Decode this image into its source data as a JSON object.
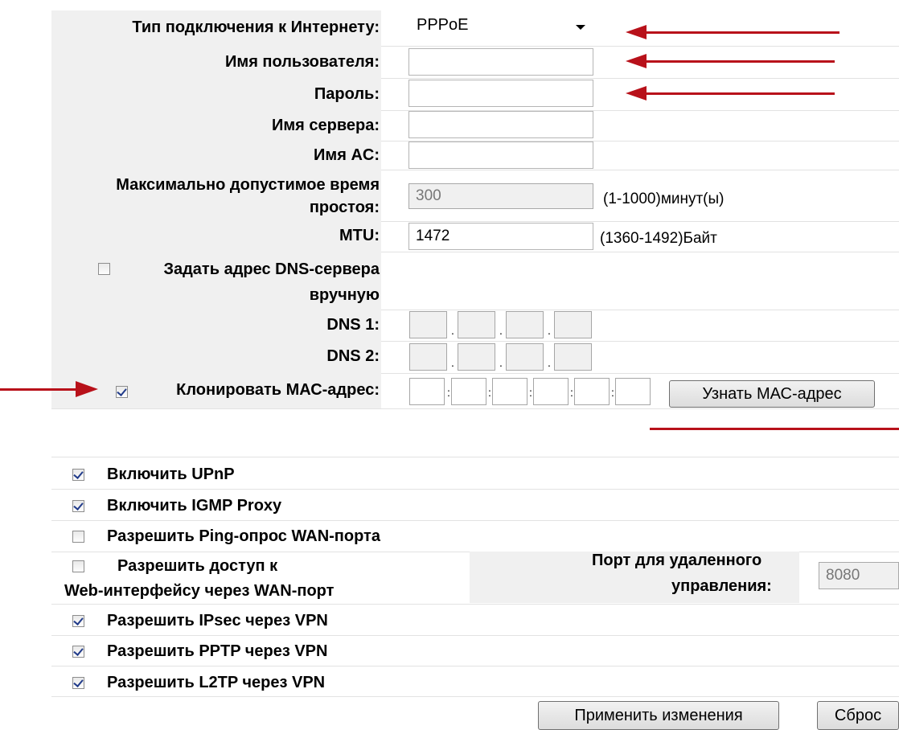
{
  "wan": {
    "connection_type_label": "Тип подключения к Интернету:",
    "connection_type_value": "PPPoE",
    "username_label": "Имя пользователя:",
    "username_value": "",
    "password_label": "Пароль:",
    "password_value": "",
    "server_name_label": "Имя сервера:",
    "server_name_value": "",
    "ac_name_label": "Имя AC:",
    "ac_name_value": "",
    "idle_time_label_line1": "Максимально допустимое время",
    "idle_time_label_line2": "простоя:",
    "idle_time_value": "300",
    "idle_time_hint": "(1-1000)минут(ы)",
    "mtu_label": "MTU:",
    "mtu_value": "1472",
    "mtu_hint": "(1360-1492)Байт",
    "dns_manual_label_line1": "Задать адрес DNS-сервера",
    "dns_manual_label_line2": "вручную",
    "dns_manual_checked": false,
    "dns1_label": "DNS 1:",
    "dns2_label": "DNS 2:",
    "clone_mac_label": "Клонировать МАС-адрес:",
    "clone_mac_checked": true,
    "get_mac_button": "Узнать МАС-адрес"
  },
  "options": {
    "upnp": {
      "label": "Включить UPnP",
      "checked": true
    },
    "igmp": {
      "label": "Включить IGMP Proxy",
      "checked": true
    },
    "ping": {
      "label": "Разрешить Ping-опрос WAN-порта",
      "checked": false
    },
    "web_access_line1": "Разрешить доступ к",
    "web_access_line2": "Web-интерфейсу через WAN-порт",
    "web_access_checked": false,
    "remote_port_label_line1": "Порт для удаленного",
    "remote_port_label_line2": "управления:",
    "remote_port_value": "8080",
    "ipsec": {
      "label": "Разрешить IPsec через VPN",
      "checked": true
    },
    "pptp": {
      "label": "Разрешить PPTP через VPN",
      "checked": true
    },
    "l2tp": {
      "label": "Разрешить L2TP через VPN",
      "checked": true
    }
  },
  "actions": {
    "apply": "Применить изменения",
    "reset": "Сброс"
  },
  "colors": {
    "annotation_arrow": "#b8111a",
    "label_background": "#f0f0f0"
  }
}
